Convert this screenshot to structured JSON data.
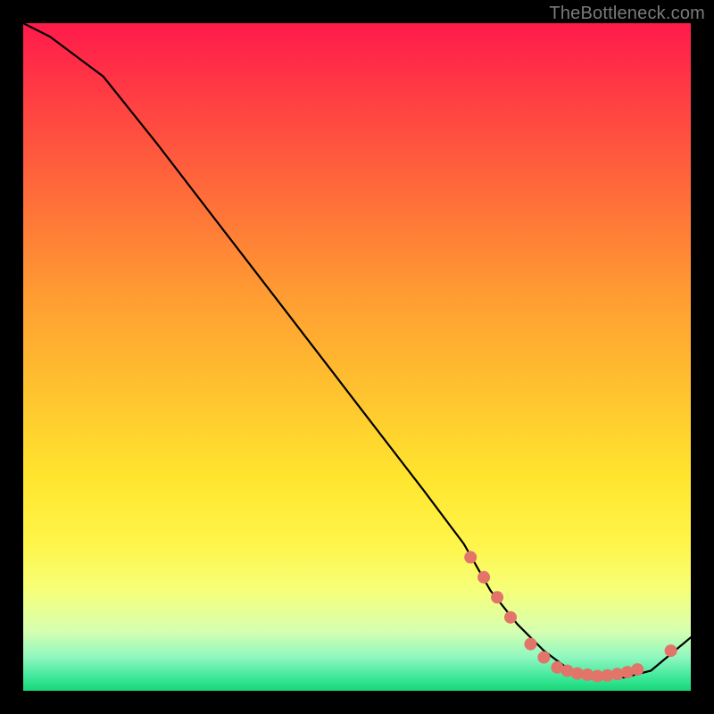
{
  "watermark": "TheBottleneck.com",
  "chart_data": {
    "type": "line",
    "title": "",
    "xlabel": "",
    "ylabel": "",
    "xlim": [
      0,
      100
    ],
    "ylim": [
      0,
      100
    ],
    "series": [
      {
        "name": "curve",
        "x": [
          0,
          4,
          8,
          12,
          20,
          30,
          40,
          50,
          60,
          66,
          70,
          74,
          78,
          82,
          86,
          90,
          94,
          100
        ],
        "y": [
          100,
          98,
          95,
          92,
          82,
          69,
          56,
          43,
          30,
          22,
          15,
          10,
          6,
          3,
          2,
          2,
          3,
          8
        ]
      }
    ],
    "markers": [
      {
        "x": 67,
        "y": 20
      },
      {
        "x": 69,
        "y": 17
      },
      {
        "x": 71,
        "y": 14
      },
      {
        "x": 73,
        "y": 11
      },
      {
        "x": 76,
        "y": 7
      },
      {
        "x": 78,
        "y": 5
      },
      {
        "x": 80,
        "y": 3.5
      },
      {
        "x": 81.5,
        "y": 3
      },
      {
        "x": 83,
        "y": 2.6
      },
      {
        "x": 84.5,
        "y": 2.4
      },
      {
        "x": 86,
        "y": 2.2
      },
      {
        "x": 87.5,
        "y": 2.3
      },
      {
        "x": 89,
        "y": 2.5
      },
      {
        "x": 90.5,
        "y": 2.8
      },
      {
        "x": 92,
        "y": 3.2
      },
      {
        "x": 97,
        "y": 6
      }
    ],
    "marker_radius": 7
  }
}
